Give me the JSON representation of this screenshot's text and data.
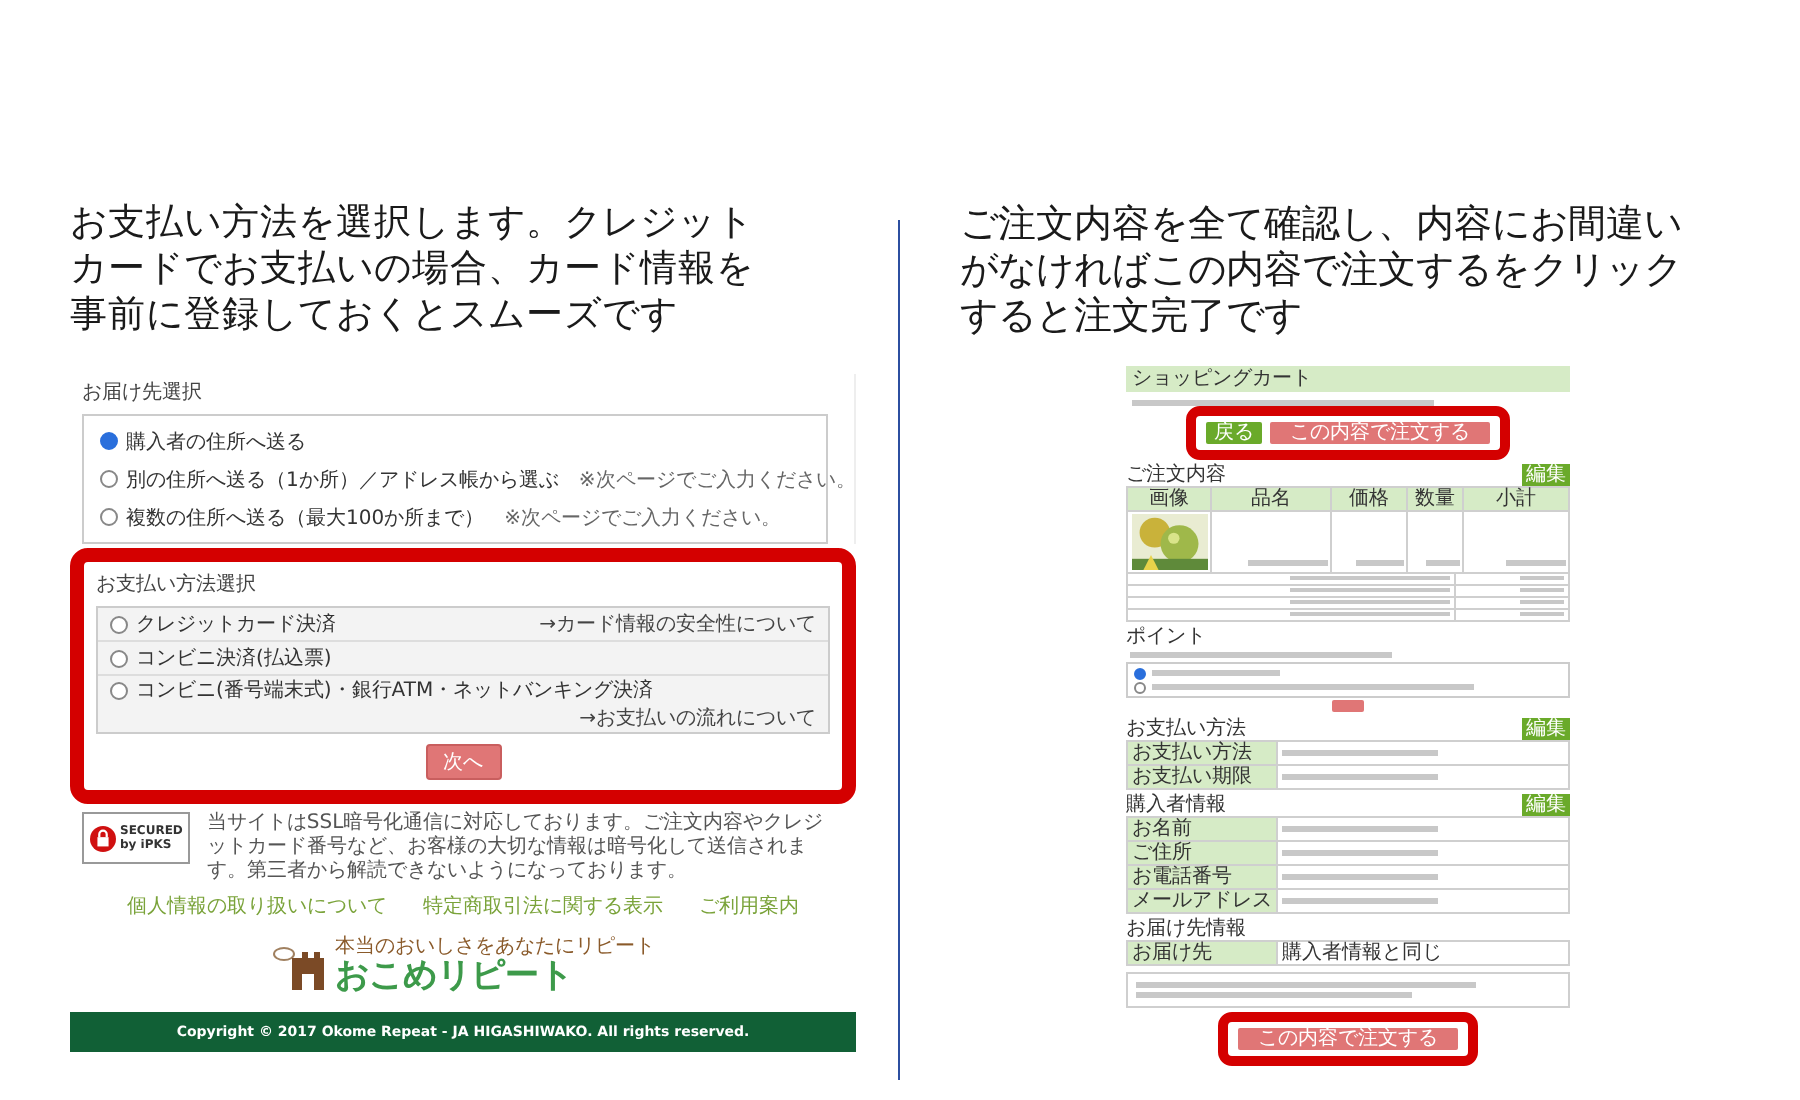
{
  "left": {
    "caption_lines": [
      "お支払い方法を選択します。クレジット",
      "カードでお支払いの場合、カード情報を",
      "事前に登録しておくとスムーズです"
    ],
    "screenshot": {
      "delivery_title": "お届け先選択",
      "delivery_options": [
        {
          "label": "購入者の住所へ送る",
          "selected": true
        },
        {
          "label": "別の住所へ送る（1か所）／アドレス帳から選ぶ",
          "note": "※次ページでご入力ください。",
          "selected": false
        },
        {
          "label": "複数の住所へ送る（最大100か所まで）",
          "note": "※次ページでご入力ください。",
          "selected": false
        }
      ],
      "payment_title": "お支払い方法選択",
      "payment_options": [
        {
          "label": "クレジットカード決済",
          "link": "→カード情報の安全性について",
          "selected": false
        },
        {
          "label": "コンビニ決済(払込票)",
          "selected": false
        },
        {
          "label": "コンビニ(番号端末式)・銀行ATM・ネットバンキング決済",
          "link": "→お支払いの流れについて",
          "selected": false
        }
      ],
      "next_button": "次へ",
      "seal_text": [
        "SECURED",
        "by iPKS"
      ],
      "security_text": "当サイトはSSL暗号化通信に対応しております。ご注文内容やクレジットカード番号など、お客様の大切な情報は暗号化して送信されます。第三者から解読できないようになっております。",
      "footer_links": [
        "個人情報の取り扱いについて",
        "特定商取引法に関する表示",
        "ご利用案内"
      ],
      "logo_tagline": "本当のおいしさをあなたにリピート",
      "logo_text": "おこめリピート",
      "copyright": "Copyright © 2017 Okome Repeat - JA HIGASHIWAKO. All rights reserved."
    }
  },
  "right": {
    "caption_lines": [
      "ご注文内容を全て確認し、内容にお間違い",
      "がなければこの内容で注文するをクリック",
      "すると注文完了です"
    ],
    "screenshot": {
      "title": "ショッピングカート",
      "top_buttons": [
        {
          "label": "戻る",
          "kind": "back"
        },
        {
          "label": "この内容で注文する",
          "kind": "order"
        }
      ],
      "sections": [
        {
          "kind": "order_table",
          "heading": "ご注文内容",
          "edit_button": "編集",
          "columns": [
            "画像",
            "品名",
            "価格",
            "数量",
            "小計"
          ]
        },
        {
          "kind": "points",
          "heading": "ポイント",
          "options": [
            {
              "selected": true
            },
            {
              "selected": false
            }
          ]
        },
        {
          "kind": "info_table",
          "heading": "お支払い方法",
          "edit_button": "編集",
          "rows": [
            {
              "label": "お支払い方法"
            },
            {
              "label": "お支払い期限"
            }
          ]
        },
        {
          "kind": "info_table",
          "heading": "購入者情報",
          "edit_button": "編集",
          "rows": [
            {
              "label": "お名前"
            },
            {
              "label": "ご住所"
            },
            {
              "label": "お電話番号"
            },
            {
              "label": "メールアドレス"
            }
          ]
        },
        {
          "kind": "info_table",
          "heading": "お届け先情報",
          "rows": [
            {
              "label": "お届け先",
              "value": "購入者情報と同じ"
            }
          ]
        }
      ],
      "bottom_button": "この内容で注文する"
    }
  }
}
